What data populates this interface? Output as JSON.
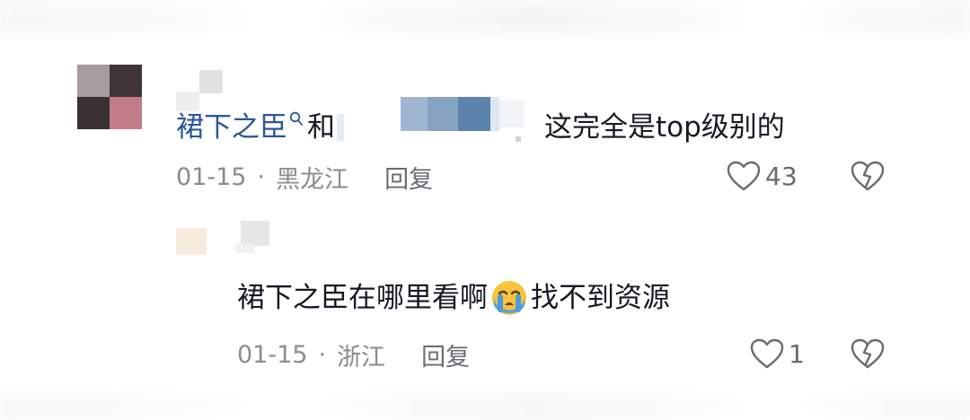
{
  "comments": [
    {
      "mention": "裙下之臣",
      "mention_suffix": "和",
      "mention_tail": "",
      "text": "这完全是top级别的",
      "date": "01-15",
      "location": "黑龙江",
      "reply_label": "回复",
      "like_count": "43"
    },
    {
      "text_before_emoji": "裙下之臣在哪里看啊",
      "emoji": "crying-face",
      "text_after_emoji": "找不到资源",
      "date": "01-15",
      "location": "浙江",
      "reply_label": "回复",
      "like_count": "1"
    }
  ],
  "separator": "·",
  "icons": {
    "like": "heart-outline-icon",
    "dislike": "broken-heart-icon",
    "search": "search-superscript-icon"
  },
  "colors": {
    "mention": "#2b5797",
    "meta": "#8a8b91",
    "text": "#161823"
  }
}
